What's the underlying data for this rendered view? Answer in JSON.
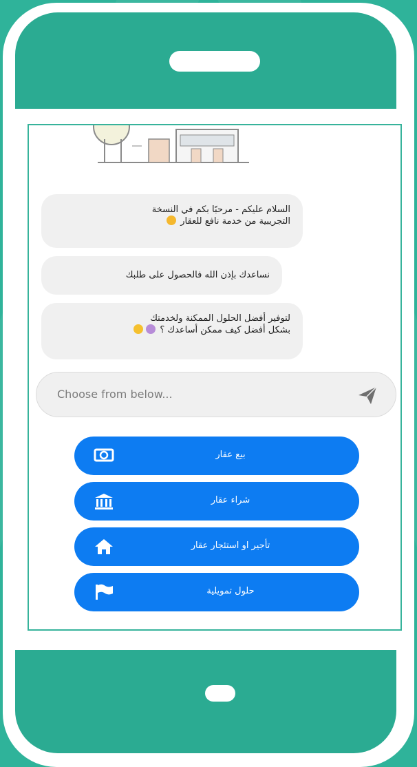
{
  "chat": {
    "messages": [
      {
        "line1": "السلام عليكم - مرحبًا بكم في النسخة",
        "line2": "التجريبية من خدمة نافع للعقار"
      },
      {
        "line1": "نساعدك بإذن الله فالحصول على طلبك"
      },
      {
        "line1": "لتوفير أفضل الحلول الممكنة ولخدمتك",
        "line2": "بشكل أفضل كيف ممكن أساعدك ؟"
      }
    ]
  },
  "composer": {
    "placeholder": "Choose from below..."
  },
  "choices": [
    {
      "label": "بيع عقار",
      "icon": "money-icon"
    },
    {
      "label": "شراء عقار",
      "icon": "bank-icon"
    },
    {
      "label": "تأجير او استئجار عقار",
      "icon": "home-icon"
    },
    {
      "label": "حلول تمويلية",
      "icon": "flag-icon"
    }
  ],
  "colors": {
    "background": "#2fb39a",
    "phone_accent": "#2bab92",
    "button": "#0d7cf2",
    "bubble": "#f0f0f0"
  }
}
